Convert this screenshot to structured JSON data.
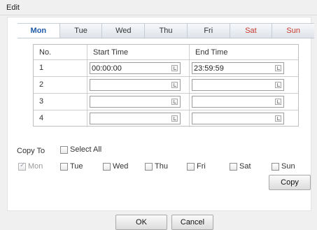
{
  "window": {
    "title": "Edit"
  },
  "tabs": [
    {
      "label": "Mon",
      "active": true,
      "weekend": false
    },
    {
      "label": "Tue",
      "active": false,
      "weekend": false
    },
    {
      "label": "Wed",
      "active": false,
      "weekend": false
    },
    {
      "label": "Thu",
      "active": false,
      "weekend": false
    },
    {
      "label": "Fri",
      "active": false,
      "weekend": false
    },
    {
      "label": "Sat",
      "active": false,
      "weekend": true
    },
    {
      "label": "Sun",
      "active": false,
      "weekend": true
    }
  ],
  "table": {
    "headers": {
      "no": "No.",
      "start": "Start Time",
      "end": "End Time"
    },
    "rows": [
      {
        "no": "1",
        "start": "00:00:00",
        "end": "23:59:59"
      },
      {
        "no": "2",
        "start": "",
        "end": ""
      },
      {
        "no": "3",
        "start": "",
        "end": ""
      },
      {
        "no": "4",
        "start": "",
        "end": ""
      }
    ]
  },
  "copy_to": {
    "label": "Copy To",
    "select_all": {
      "label": "Select All",
      "checked": false
    },
    "days": [
      {
        "label": "Mon",
        "checked": true,
        "disabled": true
      },
      {
        "label": "Tue",
        "checked": false,
        "disabled": false
      },
      {
        "label": "Wed",
        "checked": false,
        "disabled": false
      },
      {
        "label": "Thu",
        "checked": false,
        "disabled": false
      },
      {
        "label": "Fri",
        "checked": false,
        "disabled": false
      },
      {
        "label": "Sat",
        "checked": false,
        "disabled": false
      },
      {
        "label": "Sun",
        "checked": false,
        "disabled": false
      }
    ],
    "copy_button": "Copy"
  },
  "footer": {
    "ok_label": "OK",
    "cancel_label": "Cancel"
  },
  "colors": {
    "active_tab": "#1e5aa8",
    "weekend_tab": "#c8382c"
  }
}
